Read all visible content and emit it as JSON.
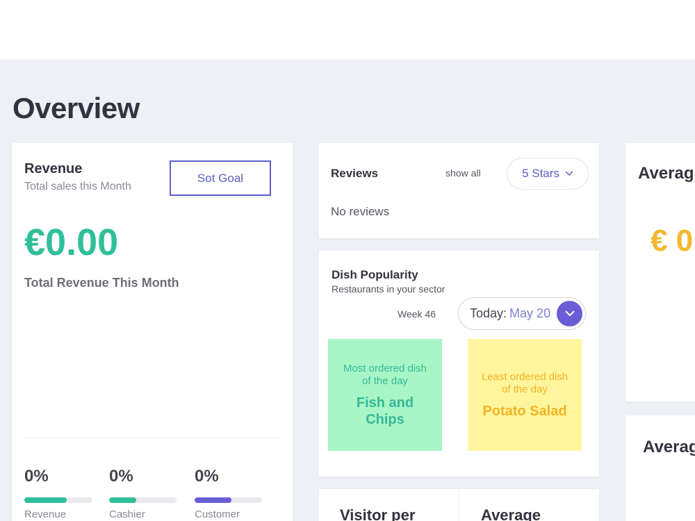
{
  "page": {
    "title": "Overview"
  },
  "revenue": {
    "title": "Revenue",
    "subtitle": "Total sales this Month",
    "set_goal_label": "Sot Goal",
    "amount": "€0.00",
    "caption": "Total Revenue This Month",
    "stats": [
      {
        "value": "0%",
        "label": "Revenue",
        "fill": 0.63,
        "color": "#2fbf9b"
      },
      {
        "value": "0%",
        "label": "Cashier",
        "fill": 0.4,
        "color": "#2fbf9b"
      },
      {
        "value": "0%",
        "label": "Customer",
        "fill": 0.55,
        "color": "#6a5ed6"
      }
    ]
  },
  "reviews": {
    "title": "Reviews",
    "show_all": "show all",
    "filter": "5 Stars",
    "empty": "No reviews"
  },
  "dish": {
    "title": "Dish Popularity",
    "subtitle": "Restaurants in your sector",
    "week": "Week 46",
    "date_label": "Today:",
    "date_value": "May 20",
    "most": {
      "caption": "Most ordered dish of the day",
      "dish": "Fish and Chips"
    },
    "least": {
      "caption": "Least ordered dish of the day",
      "dish": "Potato Salad"
    }
  },
  "bottom": {
    "left_title": "Visitor per",
    "right_title": "Average"
  },
  "right": {
    "card1_title": "Averag",
    "card1_value": "€ 0",
    "card2_title": "Averag"
  },
  "colors": {
    "accent": "#5b5fc7",
    "green": "#2fbf9b",
    "purple": "#6a5ed6",
    "orange": "#f3b324",
    "mint_tile": "#a8f5c5",
    "yellow_tile": "#fff59d"
  }
}
